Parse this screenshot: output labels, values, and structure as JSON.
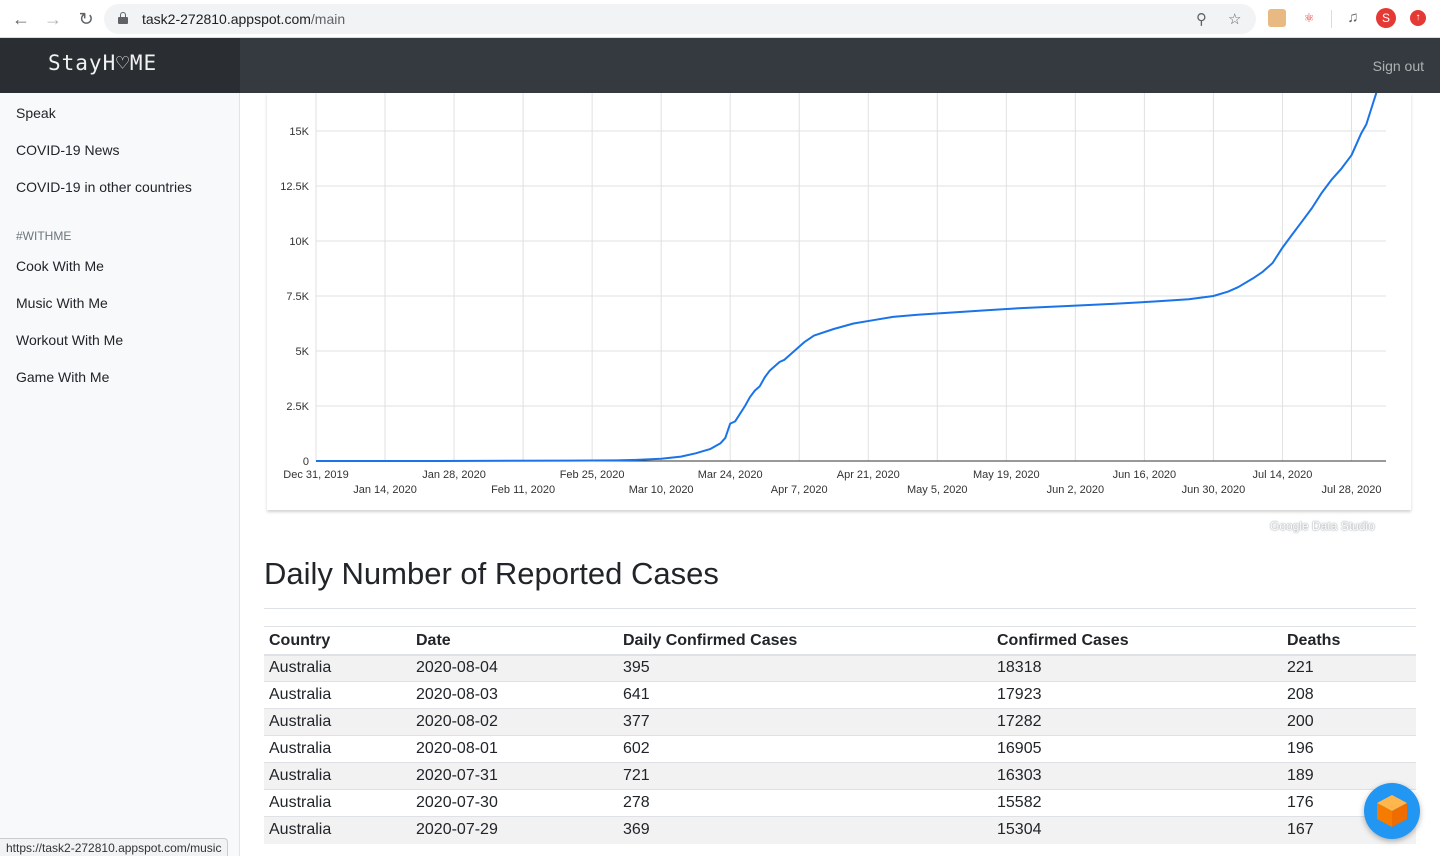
{
  "browser": {
    "url_host": "task2-272810.appspot.com",
    "url_path": "/main",
    "status_url": "https://task2-272810.appspot.com/music",
    "profile_initial": "S"
  },
  "header": {
    "brand": "StayH♡ME",
    "sign_out": "Sign out"
  },
  "sidebar": {
    "items": [
      "Speak",
      "COVID-19 News",
      "COVID-19 in other countries"
    ],
    "section_heading": "#WITHME",
    "withme_items": [
      "Cook With Me",
      "Music With Me",
      "Workout With Me",
      "Game With Me"
    ]
  },
  "chart_credit": "Google Data Studio",
  "chart_data": {
    "type": "line",
    "y_ticks": [
      "0",
      "2.5K",
      "5K",
      "7.5K",
      "10K",
      "12.5K",
      "15K"
    ],
    "ylim": [
      0,
      15000
    ],
    "x_ticks_row1": [
      "Dec 31, 2019",
      "Jan 28, 2020",
      "Feb 25, 2020",
      "Mar 24, 2020",
      "Apr 21, 2020",
      "May 19, 2020",
      "Jun 16, 2020",
      "Jul 14, 2020"
    ],
    "x_ticks_row2": [
      "Jan 14, 2020",
      "Feb 11, 2020",
      "Mar 10, 2020",
      "Apr 7, 2020",
      "May 5, 2020",
      "Jun 2, 2020",
      "Jun 30, 2020",
      "Jul 28, 2020"
    ],
    "xlim": [
      "2019-12-31",
      "2020-08-04"
    ],
    "grid": true,
    "color": "#1a73e8",
    "series": [
      {
        "x": [
          "2019-12-31",
          "2020-01-25",
          "2020-02-20",
          "2020-03-01",
          "2020-03-05",
          "2020-03-10",
          "2020-03-14",
          "2020-03-17",
          "2020-03-20",
          "2020-03-22",
          "2020-03-23",
          "2020-03-24",
          "2020-03-25",
          "2020-03-27",
          "2020-03-28",
          "2020-03-29",
          "2020-03-30",
          "2020-03-31",
          "2020-04-01",
          "2020-04-03",
          "2020-04-04",
          "2020-04-06",
          "2020-04-08",
          "2020-04-10",
          "2020-04-14",
          "2020-04-18",
          "2020-04-22",
          "2020-04-26",
          "2020-05-01",
          "2020-05-08",
          "2020-05-15",
          "2020-05-22",
          "2020-06-01",
          "2020-06-10",
          "2020-06-18",
          "2020-06-25",
          "2020-06-30",
          "2020-07-03",
          "2020-07-05",
          "2020-07-08",
          "2020-07-10",
          "2020-07-12",
          "2020-07-14",
          "2020-07-16",
          "2020-07-18",
          "2020-07-20",
          "2020-07-22",
          "2020-07-24",
          "2020-07-26",
          "2020-07-28",
          "2020-07-29",
          "2020-07-30",
          "2020-07-31",
          "2020-08-01",
          "2020-08-02",
          "2020-08-03",
          "2020-08-04"
        ],
        "y": [
          0,
          0,
          20,
          25,
          50,
          100,
          200,
          350,
          550,
          800,
          1050,
          1700,
          1800,
          2500,
          2900,
          3200,
          3400,
          3800,
          4100,
          4500,
          4600,
          5000,
          5400,
          5700,
          6000,
          6250,
          6400,
          6550,
          6650,
          6750,
          6850,
          6950,
          7050,
          7150,
          7250,
          7350,
          7500,
          7700,
          7900,
          8300,
          8600,
          9000,
          9700,
          10300,
          10900,
          11500,
          12200,
          12800,
          13300,
          13900,
          14400,
          14900,
          15300,
          16000,
          16700,
          17500,
          18318
        ]
      }
    ]
  },
  "section_title": "Daily Number of Reported Cases",
  "table": {
    "headers": [
      "Country",
      "Date",
      "Daily Confirmed Cases",
      "Confirmed Cases",
      "Deaths"
    ],
    "rows": [
      [
        "Australia",
        "2020-08-04",
        "395",
        "18318",
        "221"
      ],
      [
        "Australia",
        "2020-08-03",
        "641",
        "17923",
        "208"
      ],
      [
        "Australia",
        "2020-08-02",
        "377",
        "17282",
        "200"
      ],
      [
        "Australia",
        "2020-08-01",
        "602",
        "16905",
        "196"
      ],
      [
        "Australia",
        "2020-07-31",
        "721",
        "16303",
        "189"
      ],
      [
        "Australia",
        "2020-07-30",
        "278",
        "15582",
        "176"
      ],
      [
        "Australia",
        "2020-07-29",
        "369",
        "15304",
        "167"
      ]
    ]
  }
}
